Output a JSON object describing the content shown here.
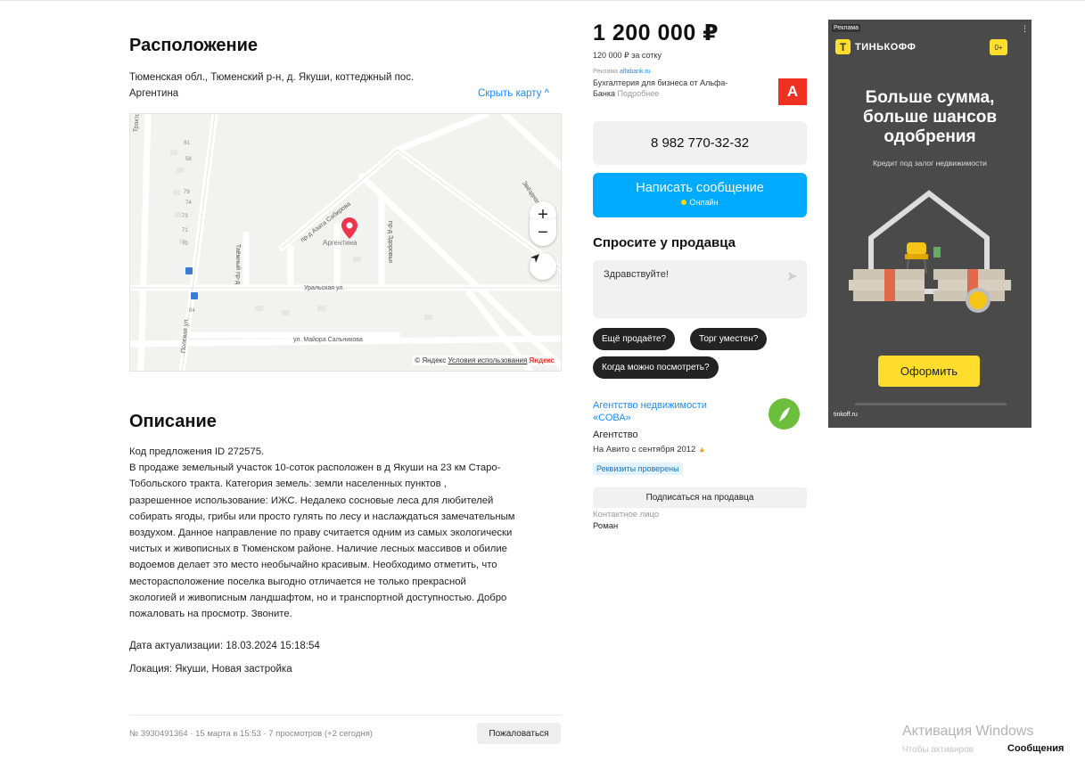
{
  "location": {
    "heading": "Расположение",
    "address_line1": "Тюменская обл., Тюменский р-н, д. Якуши, коттеджный пос.",
    "address_line2": "Аргентина",
    "hide_map": "Скрыть карту ^",
    "map": {
      "zoom_in": "+",
      "zoom_out": "−",
      "street_labels": [
        "Трактовая ул.",
        "пр-д Азата Сабирова",
        "пр-д Здоровья",
        "Таёжный пр-д",
        "Уральская ул.",
        "ул. Майора Сальникова",
        "Полевая ул.",
        "Звёздная ул."
      ],
      "pin_label": "Аргентина",
      "house_numbers": [
        "81",
        "58",
        "79",
        "74",
        "73",
        "71",
        "70",
        "84"
      ],
      "footer_prefix": "© Яндекс",
      "footer_terms": "Условия использования",
      "footer_brand": "Яндекс"
    }
  },
  "description": {
    "heading": "Описание",
    "text": "Код предложения ID 272575.\nВ продаже земельный участок 10-соток расположен в д Якуши на 23 км Старо-\nТобольского тракта. Категория земель: земли населенных пунктов ,\nразрешенное использование: ИЖС. Недалеко сосновые леса для любителей\nсобирать ягоды, грибы или просто гулять по лесу и наслаждаться замечательным\nвоздухом. Данное направление по праву считается одним из самых экологически\nчистых и живописных в Тюменском районе. Наличие лесных массивов и обилие\nводоемов делает это место необычайно красивым. Необходимо отметить, что\nместорасположение поселка выгодно отличается не только прекрасной\nэкологией и живописным ландшафтом, но и транспортной доступностью. Добро\nпожаловать на просмотр. Звоните.",
    "updated": "Дата актуализации: 18.03.2024 15:18:54",
    "locality": "Локация: Якуши, Новая застройка"
  },
  "footer": {
    "meta": "№ 3930491364 · 15 марта в 15:53 · 7 просмотров (+2 сегодня)",
    "report": "Пожаловаться"
  },
  "sidebar": {
    "price": "1 200 000 ₽",
    "price_per": "120 000 ₽ за сотку",
    "promo_label": "Реклама",
    "promo_domain": "alfabank.ru",
    "promo_text1": "Бухгалтерия для бизнеса от Альфа-",
    "promo_text2": "Банка",
    "promo_more": "Подробнее",
    "promo_logo": "А",
    "phone": "8 982 770-32-32",
    "write_message": "Написать сообщение",
    "online": "Онлайн",
    "ask_heading": "Спросите у продавца",
    "message_placeholder": "Здравствуйте!",
    "quick_q1": "Ещё продаёте?",
    "quick_q2": "Торг уместен?",
    "quick_q3": "Когда можно посмотреть?",
    "seller_name1": "Агентство недвижимости",
    "seller_name2": "«СОВА»",
    "seller_type": "Агентство",
    "seller_since": "На Авито с сентября 2012",
    "verified": "Реквизиты проверены",
    "subscribe": "Подписаться на продавца",
    "contact_label": "Контактное лицо",
    "contact_name": "Роман"
  },
  "ad": {
    "label": "Реклама",
    "brand": "ТИНЬКОФФ",
    "age": "0+",
    "title1": "Больше сумма,",
    "title2": "больше шансов",
    "title3": "одобрения",
    "subtitle": "Кредит под залог недвижимости",
    "cta": "Оформить",
    "domain": "tinkoff.ru"
  },
  "windows": {
    "activation": "Активация Windows",
    "activation_sub": "Чтобы активиров",
    "messages": "Сообщения"
  },
  "colors": {
    "accent_blue": "#00aaff",
    "link_blue": "#1a8cff",
    "pin_red": "#f0334d",
    "ad_yellow": "#ffdd2d",
    "alfa_red": "#ef3124",
    "chip_dark": "#232323"
  }
}
